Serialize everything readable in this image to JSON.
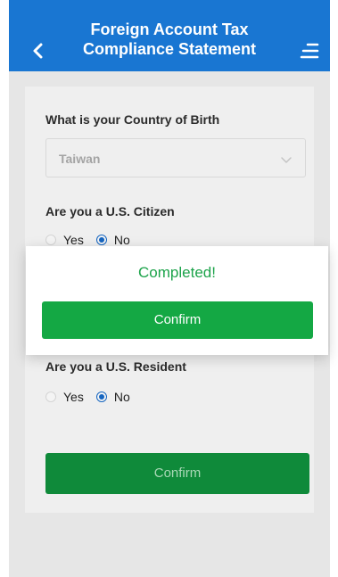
{
  "header": {
    "title": "Foreign Account Tax Compliance Statement",
    "back_icon": "chevron-left-icon",
    "menu_icon": "menu-icon"
  },
  "form": {
    "country_label": "What is your Country of Birth",
    "country_value": "Taiwan",
    "citizen_label": "Are you a U.S. Citizen",
    "resident_label": "Are you a U.S. Resident",
    "yes_label": "Yes",
    "no_label": "No",
    "citizen_selected": "No",
    "resident_selected": "No",
    "confirm_label": "Confirm"
  },
  "dialog": {
    "message": "Completed!",
    "confirm_label": "Confirm"
  },
  "colors": {
    "header": "#1976d2",
    "primary_green": "#14a844",
    "dark_green": "#0f8a3a",
    "radio_blue": "#1565c0",
    "success_text": "#1ca34a"
  }
}
